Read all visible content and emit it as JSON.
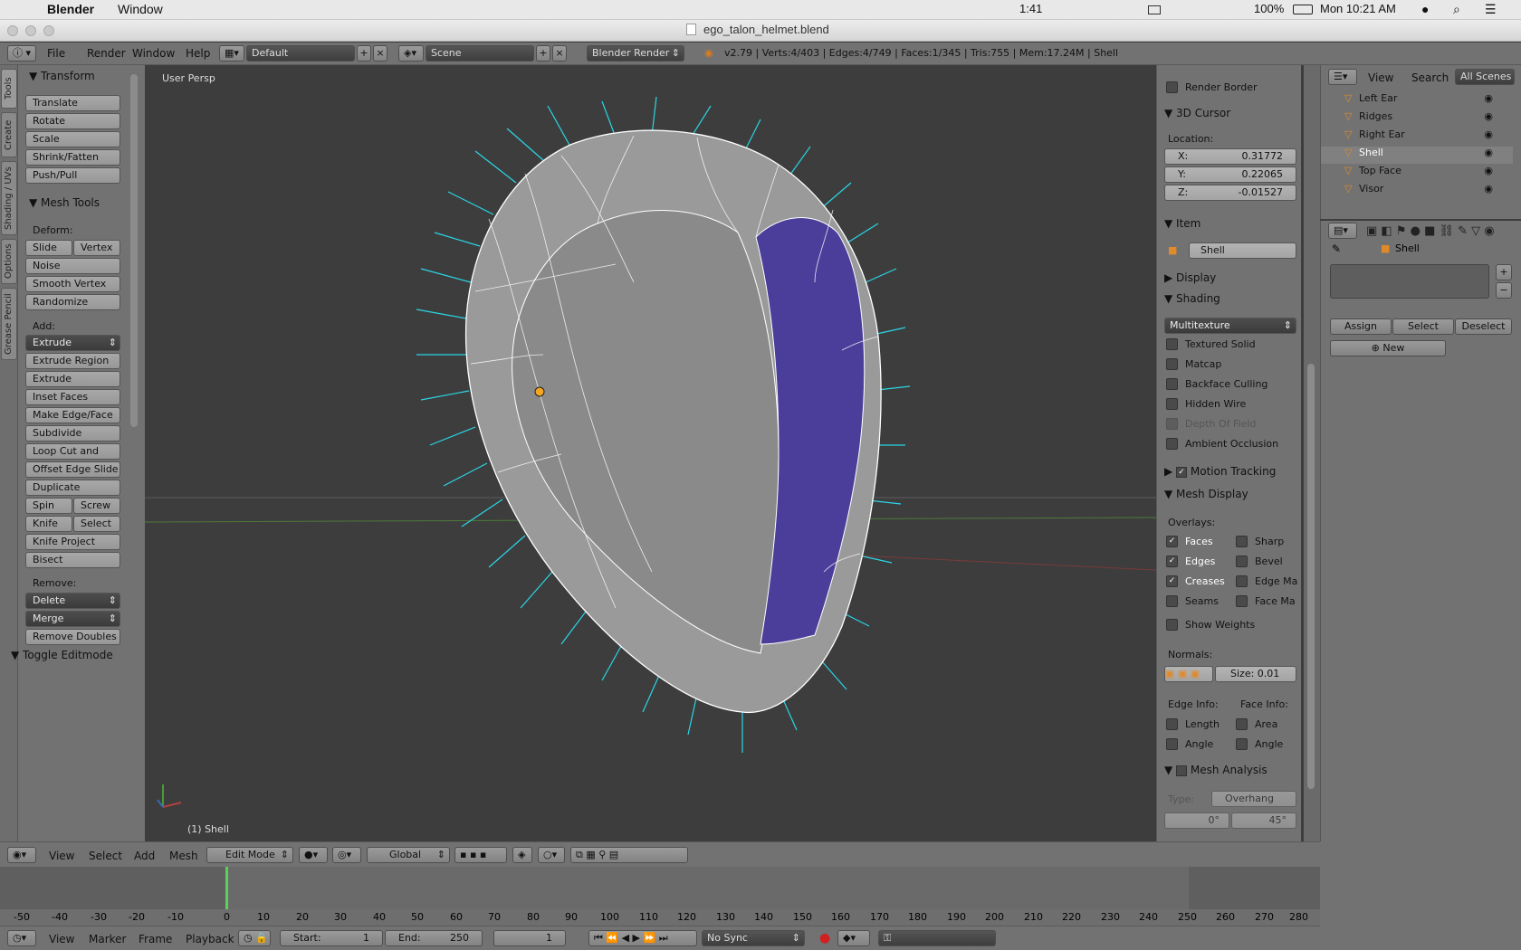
{
  "mac": {
    "app": "Blender",
    "menu_window": "Window",
    "battery_pct": "100%",
    "clock": "Mon 10:21 AM",
    "timer": "1:41"
  },
  "window": {
    "title": "ego_talon_helmet.blend"
  },
  "header": {
    "menus": [
      "File",
      "Render",
      "Window",
      "Help"
    ],
    "layout": "Default",
    "scene": "Scene",
    "engine": "Blender Render",
    "stats": "v2.79 | Verts:4/403 | Edges:4/749 | Faces:1/345 | Tris:755 | Mem:17.24M | Shell"
  },
  "tabs": [
    "Tools",
    "Create",
    "Shading / UVs",
    "Options",
    "Grease Pencil"
  ],
  "toolshelf": {
    "transform_title": "Transform",
    "transform": [
      "Translate",
      "Rotate",
      "Scale",
      "Shrink/Fatten",
      "Push/Pull"
    ],
    "meshtools_title": "Mesh Tools",
    "deform_label": "Deform:",
    "slide_edge": "Slide Ed",
    "vertex": "Vertex",
    "deform": [
      "Noise",
      "Smooth Vertex",
      "Randomize"
    ],
    "add_label": "Add:",
    "extrude": "Extrude",
    "add": [
      "Extrude Region",
      "Extrude Individual",
      "Inset Faces",
      "Make Edge/Face",
      "Subdivide",
      "Loop Cut and Slide",
      "Offset Edge Slide",
      "Duplicate"
    ],
    "spin": "Spin",
    "screw": "Screw",
    "knife": "Knife",
    "select": "Select",
    "add2": [
      "Knife Project",
      "Bisect"
    ],
    "remove_label": "Remove:",
    "delete": "Delete",
    "merge": "Merge",
    "remove_doubles": "Remove Doubles",
    "toggle_editmode": "Toggle Editmode"
  },
  "viewport": {
    "persp": "User Persp",
    "object": "(1) Shell"
  },
  "props": {
    "render_border": "Render Border",
    "cursor_title": "3D Cursor",
    "location_label": "Location:",
    "x_label": "X:",
    "x": "0.31772",
    "y_label": "Y:",
    "y": "0.22065",
    "z_label": "Z:",
    "z": "-0.01527",
    "item_title": "Item",
    "item_name": "Shell",
    "display_title": "Display",
    "shading_title": "Shading",
    "shading_mode": "Multitexture",
    "shading_opts": [
      "Textured Solid",
      "Matcap",
      "Backface Culling",
      "Hidden Wire",
      "Depth Of Field",
      "Ambient Occlusion"
    ],
    "motion_tracking": "Motion Tracking",
    "mesh_display": "Mesh Display",
    "overlays_label": "Overlays:",
    "overlays_left": [
      "Faces",
      "Edges",
      "Creases",
      "Seams"
    ],
    "overlays_right": [
      "Sharp",
      "Bevel",
      "Edge Ma",
      "Face Ma"
    ],
    "show_weights": "Show Weights",
    "normals_label": "Normals:",
    "size": "Size:  0.01",
    "edge_info": "Edge Info:",
    "face_info": "Face Info:",
    "edge_info_opts": [
      "Length",
      "Angle"
    ],
    "face_info_opts": [
      "Area",
      "Angle"
    ],
    "mesh_analysis": "Mesh Analysis",
    "type_label": "Type:",
    "type_value": "Overhang",
    "angle_min": "0°",
    "angle_max": "45°"
  },
  "outliner": {
    "view": "View",
    "search": "Search",
    "all_scenes": "All Scenes",
    "items": [
      "Left Ear",
      "Ridges",
      "Right Ear",
      "Shell",
      "Top Face",
      "Visor"
    ]
  },
  "propeditor": {
    "object": "Shell",
    "assign": "Assign",
    "select": "Select",
    "deselect": "Deselect",
    "new": "New"
  },
  "vpheader": {
    "menus": [
      "View",
      "Select",
      "Add",
      "Mesh"
    ],
    "mode": "Edit Mode",
    "orientation": "Global"
  },
  "timeline": {
    "ticks": [
      "-50",
      "-40",
      "-30",
      "-20",
      "-10",
      "0",
      "10",
      "20",
      "30",
      "40",
      "50",
      "60",
      "70",
      "80",
      "90",
      "100",
      "110",
      "120",
      "130",
      "140",
      "150",
      "160",
      "170",
      "180",
      "190",
      "200",
      "210",
      "220",
      "230",
      "240",
      "250",
      "260",
      "270",
      "280"
    ],
    "current_frame": 1
  },
  "tlheader": {
    "menus": [
      "View",
      "Marker",
      "Frame",
      "Playback"
    ],
    "start": "Start:",
    "start_val": "1",
    "end": "End:",
    "end_val": "250",
    "frame": "1",
    "sync": "No Sync"
  },
  "colors": {
    "selected_orange": "#f5a623",
    "normals": "#2ad6e6",
    "visor": "#4b3e9a"
  }
}
